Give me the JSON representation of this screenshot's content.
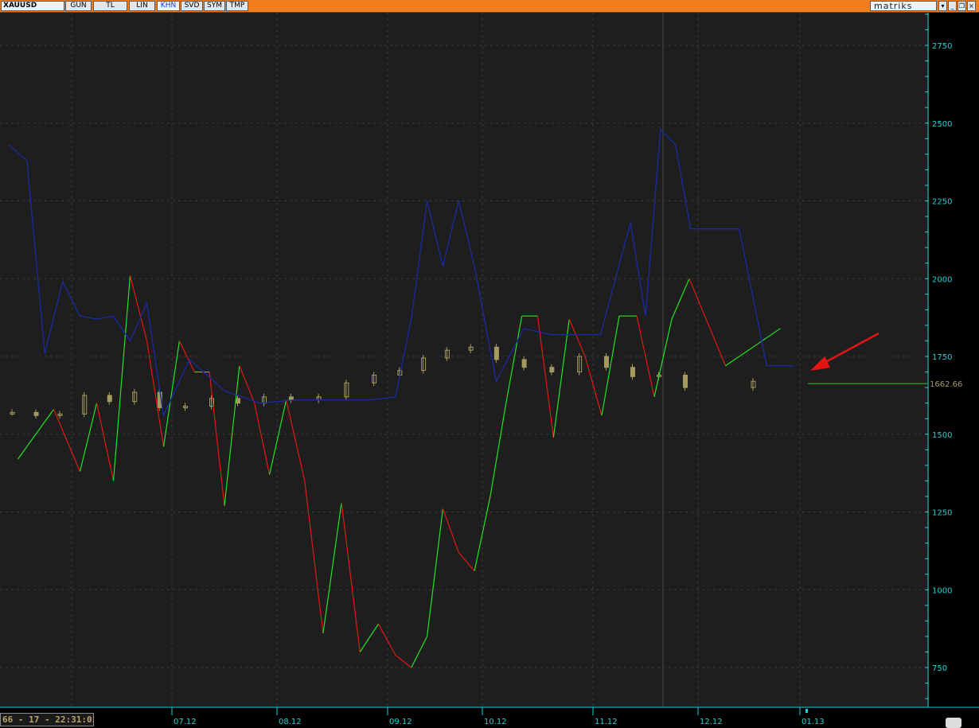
{
  "toolbar": {
    "symbol": "XAUUSD",
    "buttons": [
      "GUN",
      "TL",
      "LIN",
      "KHN",
      "SVD",
      "SYM",
      "TMP"
    ],
    "active_button": "KHN",
    "brand": "matriks",
    "window_controls": [
      "dropdown-icon",
      "minimize-icon",
      "restore-icon",
      "close-icon"
    ]
  },
  "status": {
    "text": "66 - 17 - 22:31:01"
  },
  "colors": {
    "background": "#1e1e1e",
    "axis": "#1fd1d4",
    "price": "#a39a5f",
    "indicator_up": "#22e322",
    "indicator_down": "#e01a12",
    "stop_line": "#1a2a9a",
    "last_price_line": "#28d028",
    "arrow": "#e51414"
  },
  "chart_data": {
    "type": "line",
    "ylim": [
      600,
      2840
    ],
    "yticks": [
      750,
      1000,
      1250,
      1500,
      1750,
      2000,
      2250,
      2500,
      2750
    ],
    "xticks": [
      "07.12",
      "08.12",
      "09.12",
      "10.12",
      "11.12",
      "12.12",
      "01.13"
    ],
    "last_price_label": "1662.66",
    "grid": true,
    "series": [
      {
        "kind": "price",
        "x": [
          "06.12",
          "06.12",
          "06.12",
          "07.12",
          "07.12",
          "07.12",
          "07.12",
          "08.12",
          "08.12",
          "08.12",
          "08.12",
          "09.12",
          "09.12",
          "09.12",
          "09.12",
          "10.12",
          "10.12",
          "10.12",
          "10.12",
          "11.12",
          "11.12",
          "11.12",
          "11.12",
          "12.12",
          "12.12",
          "12.12",
          "12.12",
          "01.13"
        ],
        "values": [
          1570,
          1560,
          1565,
          1625,
          1605,
          1635,
          1585,
          1590,
          1615,
          1600,
          1620,
          1610,
          1620,
          1665,
          1690,
          1705,
          1745,
          1770,
          1780,
          1740,
          1715,
          1700,
          1750,
          1715,
          1685,
          1690,
          1650,
          1670
        ]
      },
      {
        "kind": "indicator",
        "x": [
          "06.12",
          "06.12",
          "07.12",
          "07.12",
          "07.12",
          "07.12",
          "07.12",
          "07.12",
          "08.12",
          "08.12",
          "08.12",
          "08.12",
          "08.12",
          "08.12",
          "08.12",
          "09.12",
          "09.12",
          "09.12",
          "09.12",
          "09.12",
          "09.12",
          "10.12",
          "10.12",
          "10.12",
          "10.12",
          "10.12",
          "10.12",
          "11.12",
          "11.12",
          "11.12",
          "11.12",
          "11.12",
          "11.12",
          "11.12",
          "12.12",
          "12.12",
          "12.12",
          "12.12",
          "12.12",
          "12.12",
          "01.13",
          "01.13"
        ],
        "values": [
          1420,
          1580,
          1380,
          1600,
          1350,
          2010,
          1800,
          1460,
          1800,
          1700,
          1700,
          1270,
          1720,
          1600,
          1370,
          1610,
          1350,
          860,
          1280,
          800,
          890,
          790,
          750,
          850,
          1260,
          1120,
          1060,
          1300,
          1600,
          1880,
          1880,
          1490,
          1870,
          1750,
          1560,
          1880,
          1880,
          1620,
          1870,
          2000,
          1720,
          1840
        ]
      },
      {
        "kind": "stop",
        "x": [
          "06.12",
          "06.12",
          "06.12",
          "06.12",
          "07.12",
          "07.12",
          "07.12",
          "07.12",
          "07.12",
          "07.12",
          "08.12",
          "08.12",
          "08.12",
          "09.12",
          "09.12",
          "09.12",
          "10.12",
          "10.12",
          "10.12",
          "10.12",
          "10.12",
          "10.12",
          "11.12",
          "11.12",
          "11.12",
          "11.12",
          "12.12",
          "12.12",
          "12.12",
          "12.12",
          "12.12",
          "12.12",
          "12.12",
          "01.13",
          "01.13",
          "01.13",
          "01.13"
        ],
        "values": [
          2430,
          2380,
          1760,
          1990,
          1880,
          1870,
          1880,
          1800,
          1920,
          1560,
          1740,
          1640,
          1600,
          1610,
          1610,
          1610,
          1620,
          1870,
          2250,
          2040,
          2250,
          2040,
          1670,
          1840,
          1820,
          1820,
          1820,
          2000,
          2180,
          1880,
          2480,
          2430,
          2160,
          2160,
          2160,
          1720,
          1720
        ]
      }
    ]
  }
}
